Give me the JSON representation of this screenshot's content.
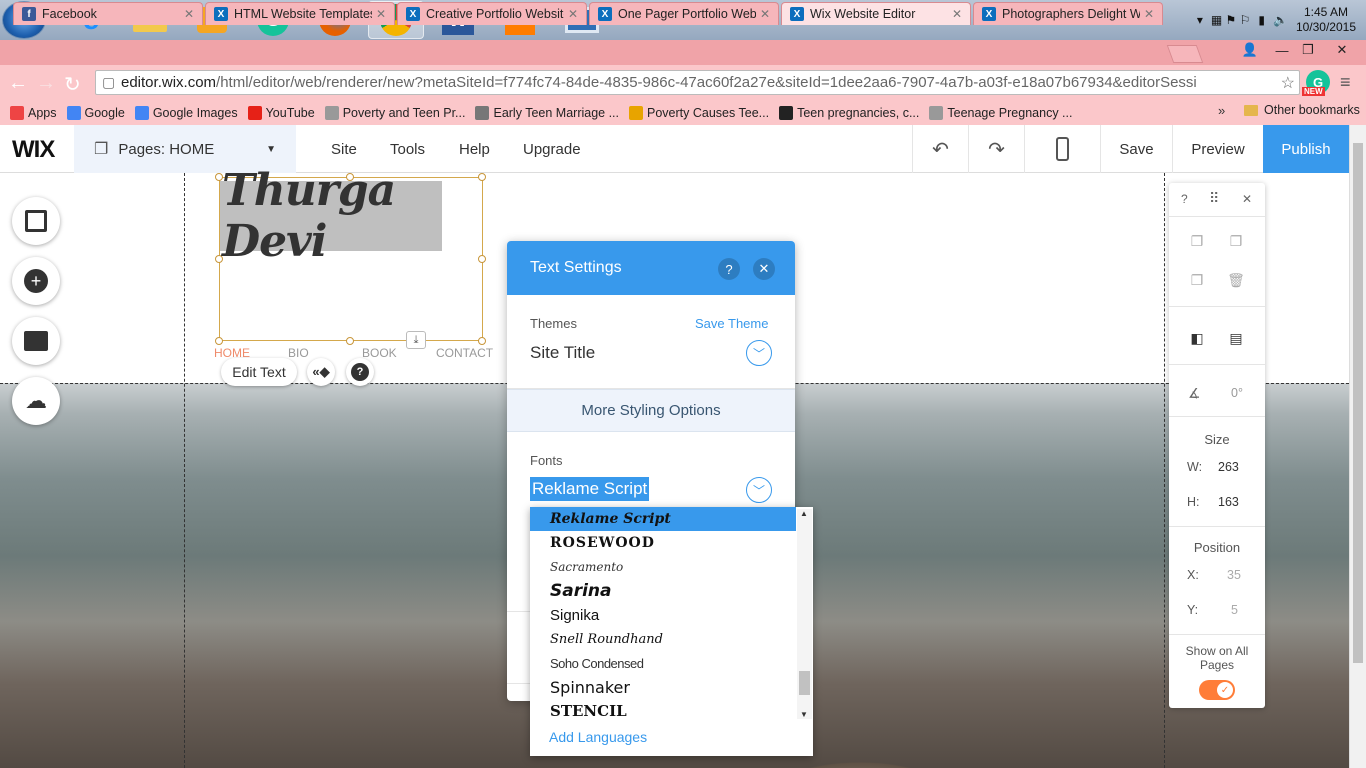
{
  "taskbar": {
    "apps": [
      "windows-start",
      "internet-explorer",
      "file-explorer",
      "media-player",
      "grammarly",
      "firefox",
      "chrome",
      "word",
      "illustrator",
      "display-settings"
    ],
    "illustrator_label": "Ai",
    "word_label": "W",
    "clock_time": "1:45 AM",
    "clock_date": "10/30/2015"
  },
  "browser": {
    "tabs": [
      {
        "title": "Facebook",
        "icon": "facebook-icon",
        "color": "#3b5998",
        "active": false
      },
      {
        "title": "HTML Website Templates",
        "icon": "wix-icon",
        "color": "#0c6ebd",
        "active": false
      },
      {
        "title": "Creative Portfolio Website",
        "icon": "wix-icon",
        "color": "#0c6ebd",
        "active": false
      },
      {
        "title": "One Pager Portfolio Webs",
        "icon": "wix-icon",
        "color": "#0c6ebd",
        "active": false
      },
      {
        "title": "Wix Website Editor",
        "icon": "wix-icon",
        "color": "#0c6ebd",
        "active": true
      },
      {
        "title": "Photographers Delight W",
        "icon": "wix-icon",
        "color": "#0c6ebd",
        "active": false
      }
    ],
    "url_prefix": "editor.wix.com",
    "url_rest": "/html/editor/web/renderer/new?metaSiteId=f774fc74-84de-4835-986c-47ac60f2a27e&siteId=1dee2aa6-7907-4a7b-a03f-e18a07b67934&editorSessi",
    "new_badge": "NEW",
    "bookmarks": [
      {
        "label": "Apps",
        "icon": "apps-icon",
        "color": "#e44"
      },
      {
        "label": "Google",
        "icon": "google-icon",
        "color": "#4285f4"
      },
      {
        "label": "Google Images",
        "icon": "google-icon",
        "color": "#4285f4"
      },
      {
        "label": "YouTube",
        "icon": "youtube-icon",
        "color": "#e62117"
      },
      {
        "label": "Poverty and Teen Pr...",
        "icon": "page-icon",
        "color": "#999"
      },
      {
        "label": "Early Teen Marriage ...",
        "icon": "page-icon",
        "color": "#777"
      },
      {
        "label": "Poverty Causes Tee...",
        "icon": "check-icon",
        "color": "#e8a400"
      },
      {
        "label": "Teen pregnancies, c...",
        "icon": "site-icon",
        "color": "#222"
      },
      {
        "label": "Teenage Pregnancy ...",
        "icon": "page-icon",
        "color": "#999"
      }
    ],
    "bookmarks_more": "»",
    "other_bookmarks": "Other bookmarks"
  },
  "editor": {
    "logo": "WIX",
    "pages_label": "Pages: HOME",
    "menu": [
      "Site",
      "Tools",
      "Help",
      "Upgrade"
    ],
    "save": "Save",
    "preview": "Preview",
    "publish": "Publish"
  },
  "canvas": {
    "site_title": "Thurga Devi",
    "nav": [
      "HOME",
      "BIO",
      "BOOK",
      "CONTACT"
    ],
    "edit_text": "Edit Text",
    "help": "?"
  },
  "text_settings": {
    "title": "Text Settings",
    "help": "?",
    "themes_label": "Themes",
    "save_theme": "Save Theme",
    "theme_value": "Site Title",
    "more_styling": "More Styling Options",
    "fonts_label": "Fonts",
    "font_value": "Reklame Script",
    "font_options": [
      "Reklame Script",
      "ROSEWOOD",
      "Sacramento",
      "Sarina",
      "Signika",
      "Snell Roundhand",
      "Soho Condensed",
      "Spinnaker",
      "STENCIL"
    ],
    "selected_font": "Reklame Script",
    "add_languages": "Add Languages"
  },
  "inspector": {
    "help": "?",
    "rotation": "0°",
    "size_label": "Size",
    "w_label": "W:",
    "w_value": "263",
    "h_label": "H:",
    "h_value": "163",
    "position_label": "Position",
    "x_label": "X:",
    "x_value": "35",
    "y_label": "Y:",
    "y_value": "5",
    "show_all_pages": "Show on All Pages",
    "show_all_pages_on": true,
    "accent": "#ff7d38"
  },
  "colors": {
    "wix_blue": "#3899ec",
    "chrome_pink": "#fbc7ca"
  }
}
